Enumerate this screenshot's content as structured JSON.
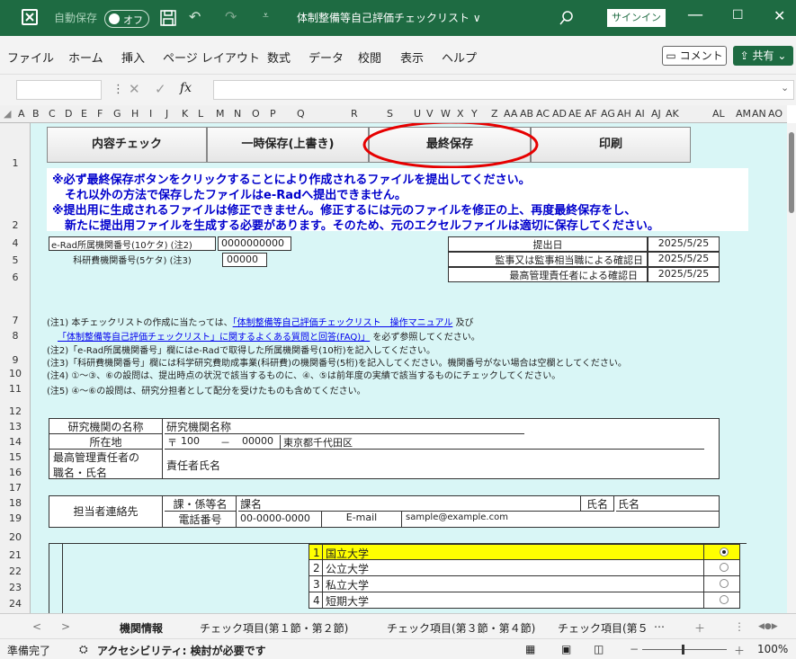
{
  "titlebar": {
    "autosave_label": "自動保存",
    "autosave_state": "オフ",
    "filename": "体制整備等自己評価チェックリスト ∨",
    "signin": "サインイン"
  },
  "menu": [
    "ファイル",
    "ホーム",
    "挿入",
    "ページ レイアウト",
    "数式",
    "データ",
    "校閲",
    "表示",
    "ヘルプ"
  ],
  "comment_label": "コメント",
  "share_label": "共有",
  "formula_bar": {
    "fx": "fx",
    "value": ""
  },
  "columns": [
    "A",
    "B",
    "C",
    "D",
    "E",
    "F",
    "G",
    "H",
    "I",
    "J",
    "K",
    "L",
    "M",
    "N",
    "O",
    "P",
    "Q",
    "R",
    "S",
    "U",
    "V",
    "W",
    "X",
    "Y",
    "Z",
    "AA",
    "AB",
    "AC",
    "AD",
    "AE",
    "AF",
    "AG",
    "AH",
    "AI",
    "AJ",
    "AK",
    "AL",
    "AM",
    "AN",
    "AO"
  ],
  "rows": [
    "1",
    "2",
    "4",
    "5",
    "6",
    "7",
    "8",
    "9",
    "10",
    "11",
    "12",
    "13",
    "14",
    "15",
    "16",
    "17",
    "18",
    "19",
    "20",
    "21",
    "22",
    "23",
    "24"
  ],
  "buttons": {
    "check": "内容チェック",
    "temp_save": "一時保存(上書き)",
    "final_save": "最終保存",
    "print": "印刷"
  },
  "notes": [
    "※必ず最終保存ボタンをクリックすることにより作成されるファイルを提出してください。",
    "それ以外の方法で保存したファイルはe-Radへ提出できません。",
    "※提出用に生成されるファイルは修正できません。修正するには元のファイルを修正の上、再度最終保存をし、",
    "新たに提出用ファイルを生成する必要があります。そのため、元のエクセルファイルは適切に保存してください。"
  ],
  "ids": {
    "erad_label": "e-Rad所属機関番号(10ケタ) (注2)",
    "erad_value": "0000000000",
    "kaken_label": "科研費機関番号(5ケタ) (注3)",
    "kaken_value": "00000"
  },
  "dates": {
    "submit_label": "提出日",
    "submit_value": "2025/5/25",
    "audit_label": "監事又は監事相当職による確認日",
    "audit_value": "2025/5/25",
    "manager_label": "最高管理責任者による確認日",
    "manager_value": "2025/5/25"
  },
  "footnotes": {
    "n1a": "(注1) 本チェックリストの作成に当たっては、",
    "n1link1": "「体制整備等自己評価チェックリスト　操作マニュアル",
    "n1b": " 及び",
    "n1link2": "「体制整備等自己評価チェックリスト」に関するよくある質問と回答(FAQ)」",
    "n1c": " を必ず参照してください。",
    "n2": "(注2)「e-Rad所属機関番号」欄にはe-Radで取得した所属機関番号(10桁)を記入してください。",
    "n3": "(注3)「科研費機関番号」欄には科学研究費助成事業(科研費)の機関番号(5桁)を記入してください。機関番号がない場合は空欄としてください。",
    "n4": "(注4) ①～③、⑥の設問は、提出時点の状況で該当するものに、④、⑤は前年度の実績で該当するものにチェックしてください。",
    "n5": "(注5) ④～⑥の設問は、研究分担者として配分を受けたものも含めてください。"
  },
  "institution": {
    "name_label": "研究機関の名称",
    "name_value": "研究機関名称",
    "address_label": "所在地",
    "zip_mark": "〒",
    "zip1": "100",
    "zip_dash": "－",
    "zip2": "00000",
    "address_value": "東京都千代田区",
    "manager_label1": "最高管理責任者の",
    "manager_label2": "職名・氏名",
    "manager_value": "責任者氏名"
  },
  "contact": {
    "label": "担当者連絡先",
    "dept_label": "課・係等名",
    "dept_value": "課名",
    "name_label": "氏名",
    "name_value": "氏名",
    "tel_label": "電話番号",
    "tel_value": "00-0000-0000",
    "email_label": "E-mail",
    "email_value": "sample@example.com"
  },
  "types": [
    {
      "num": "1",
      "label": "国立大学",
      "selected": true
    },
    {
      "num": "2",
      "label": "公立大学",
      "selected": false
    },
    {
      "num": "3",
      "label": "私立大学",
      "selected": false
    },
    {
      "num": "4",
      "label": "短期大学",
      "selected": false
    }
  ],
  "tabs": [
    "機関情報",
    "チェック項目(第１節・第２節)",
    "チェック項目(第３節・第４節)",
    "チェック項目(第５"
  ],
  "status": {
    "ready": "準備完了",
    "accessibility": "アクセシビリティ: 検討が必要です",
    "zoom": "100%"
  },
  "colors": {
    "excel_green": "#1e6b42",
    "sheet_bg": "#d9f6f6",
    "note_blue": "#0000cc",
    "highlight": "#ffff00",
    "circle": "#e60000"
  }
}
